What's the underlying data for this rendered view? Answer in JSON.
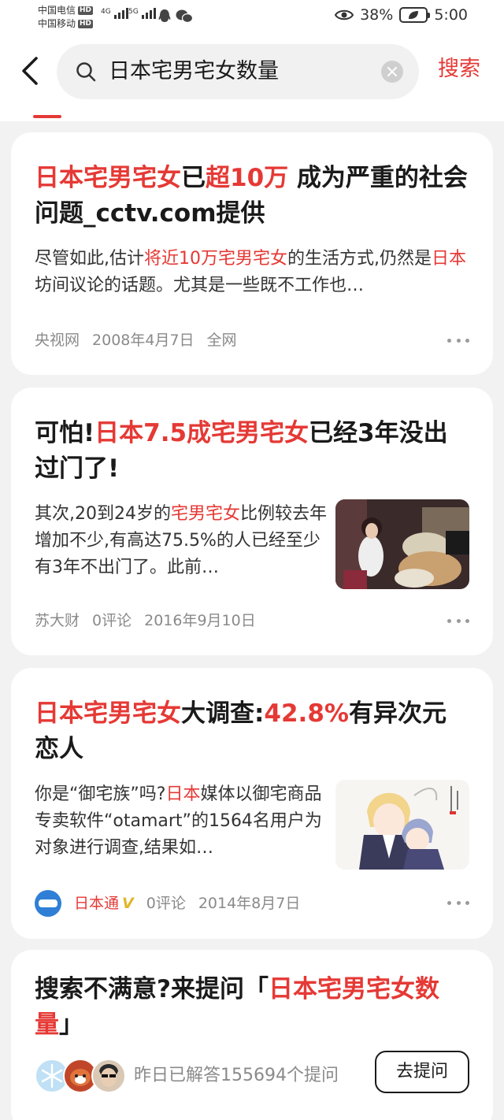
{
  "status_bar": {
    "carrier1": "中国电信",
    "carrier2": "中国移动",
    "hd": "HD",
    "net1": "4G",
    "net2": "5G",
    "battery_percent": "38%",
    "time": "5:00",
    "battery_level": 0.38
  },
  "search": {
    "query": "日本宅男宅女数量",
    "submit_label": "搜索"
  },
  "results": [
    {
      "title_parts": [
        {
          "text": "日本宅男宅女",
          "hl": true
        },
        {
          "text": "已",
          "hl": false
        },
        {
          "text": "超10万",
          "hl": true
        },
        {
          "text": " 成为严重的社会问题_cctv.com提供",
          "hl": false
        }
      ],
      "snippet_parts": [
        {
          "text": "尽管如此,估计",
          "hl": false
        },
        {
          "text": "将近10万宅男宅女",
          "hl": true
        },
        {
          "text": "的生活方式,仍然是",
          "hl": false
        },
        {
          "text": "日本",
          "hl": true
        },
        {
          "text": "坊间议论的话题。尤其是一些既不工作也…",
          "hl": false
        }
      ],
      "source": "央视网",
      "date": "2008年4月7日",
      "extra": "全网"
    },
    {
      "title_parts": [
        {
          "text": "可怕!",
          "hl": false
        },
        {
          "text": "日本7.5成宅男宅女",
          "hl": true
        },
        {
          "text": "已经3年没出过门了!",
          "hl": false
        }
      ],
      "snippet_parts": [
        {
          "text": "其次,20到24岁的",
          "hl": false
        },
        {
          "text": "宅男宅女",
          "hl": true
        },
        {
          "text": "比例较去年增加不少,有高达75.5%的人已经至少有3年不出门了。此前…",
          "hl": false
        }
      ],
      "source": "苏大财",
      "comments": "0评论",
      "date": "2016年9月10日",
      "thumbnail": "photo-person-cluttered-room"
    },
    {
      "title_parts": [
        {
          "text": "日本宅男宅女",
          "hl": true
        },
        {
          "text": "大调查:",
          "hl": false
        },
        {
          "text": "42.8%",
          "hl": true
        },
        {
          "text": "有异次元恋人",
          "hl": false
        }
      ],
      "snippet_parts": [
        {
          "text": "你是“御宅族”吗?",
          "hl": false
        },
        {
          "text": "日本",
          "hl": true
        },
        {
          "text": "媒体以御宅商品专卖软件“otamart”的1564名用户为对象进行调查,结果如…",
          "hl": false
        }
      ],
      "source": "日本通",
      "verified": "V",
      "comments": "0评论",
      "date": "2014年8月7日",
      "thumbnail": "anime-illustration"
    }
  ],
  "ask": {
    "title_prefix": "搜索不满意?来提问「",
    "title_highlight": "日本宅男宅女数量",
    "title_suffix": "」",
    "answered_info": "昨日已解答155694个提问",
    "button_label": "去提问"
  },
  "colors": {
    "accent": "#e53935",
    "background": "#f2f2f2",
    "card": "#ffffff",
    "meta": "#8a8a8a"
  }
}
